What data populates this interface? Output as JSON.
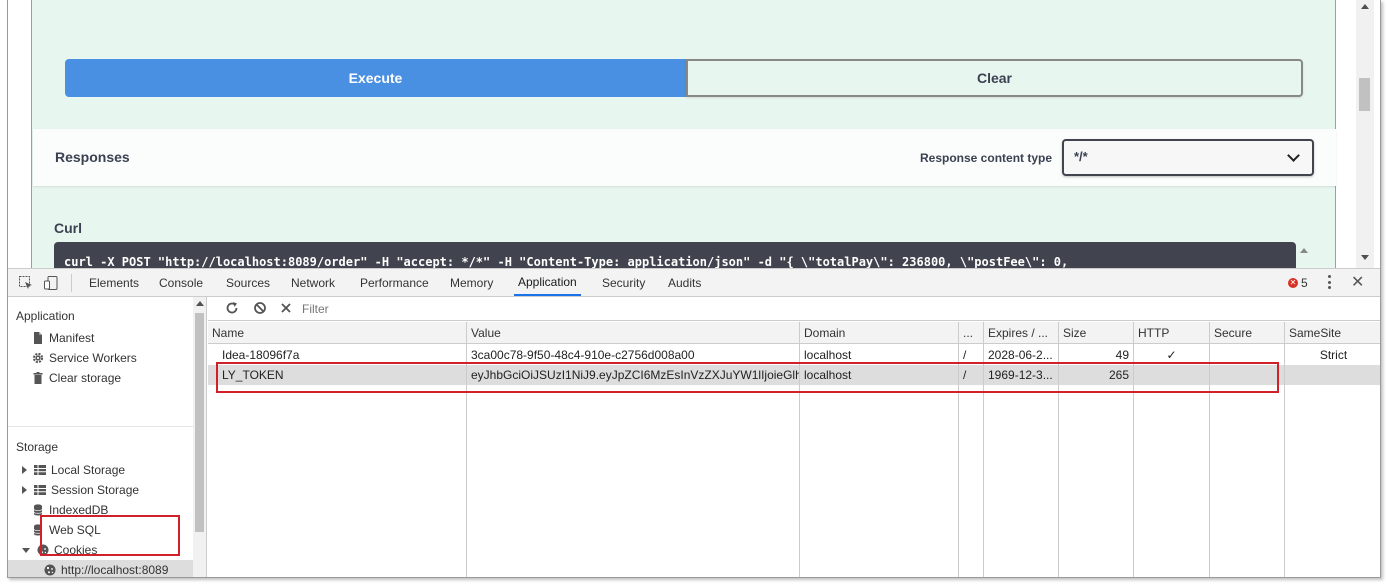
{
  "swagger": {
    "execute_label": "Execute",
    "clear_label": "Clear",
    "responses_title": "Responses",
    "response_content_type_label": "Response content type",
    "response_content_type_value": "*/*",
    "curl_title": "Curl",
    "curl_command": "curl -X POST \"http://localhost:8089/order\" -H \"accept: */*\" -H \"Content-Type: application/json\" -d \"{ \\\"totalPay\\\": 236800, \\\"postFee\\\": 0,"
  },
  "devtools": {
    "tabs": [
      {
        "label": "Elements"
      },
      {
        "label": "Console"
      },
      {
        "label": "Sources"
      },
      {
        "label": "Network"
      },
      {
        "label": "Performance"
      },
      {
        "label": "Memory"
      },
      {
        "label": "Application"
      },
      {
        "label": "Security"
      },
      {
        "label": "Audits"
      }
    ],
    "active_tab": "Application",
    "error_count": "5",
    "accent_color": "#1a73e8",
    "error_color": "#d93025"
  },
  "sidebar": {
    "application_heading": "Application",
    "application_items": [
      {
        "label": "Manifest",
        "icon": "file-icon"
      },
      {
        "label": "Service Workers",
        "icon": "gear-icon"
      },
      {
        "label": "Clear storage",
        "icon": "trash-icon"
      }
    ],
    "storage_heading": "Storage",
    "storage_items": [
      {
        "label": "Local Storage",
        "icon": "grid-icon"
      },
      {
        "label": "Session Storage",
        "icon": "grid-icon"
      },
      {
        "label": "IndexedDB",
        "icon": "database-icon"
      },
      {
        "label": "Web SQL",
        "icon": "database-icon"
      },
      {
        "label": "Cookies",
        "icon": "cookie-icon"
      }
    ],
    "cookie_origin": "http://localhost:8089"
  },
  "cookies": {
    "filter_placeholder": "Filter",
    "columns": [
      "Name",
      "Value",
      "Domain",
      "...",
      "Expires / ...",
      "Size",
      "HTTP",
      "Secure",
      "SameSite"
    ],
    "rows": [
      {
        "name": "Idea-18096f7a",
        "value": "3ca00c78-9f50-48c4-910e-c2756d008a00",
        "domain": "localhost",
        "path": "/",
        "expires": "2028-06-2...",
        "size": "49",
        "http": "✓",
        "secure": "",
        "samesite": "Strict"
      },
      {
        "name": "LY_TOKEN",
        "value": "eyJhbGciOiJSUzI1NiJ9.eyJpZCI6MzEsInVzZXJuYW1lIjoieGlh...",
        "domain": "localhost",
        "path": "/",
        "expires": "1969-12-3...",
        "size": "265",
        "http": "",
        "secure": "",
        "samesite": ""
      }
    ]
  },
  "highlight_color": "#d0202a"
}
